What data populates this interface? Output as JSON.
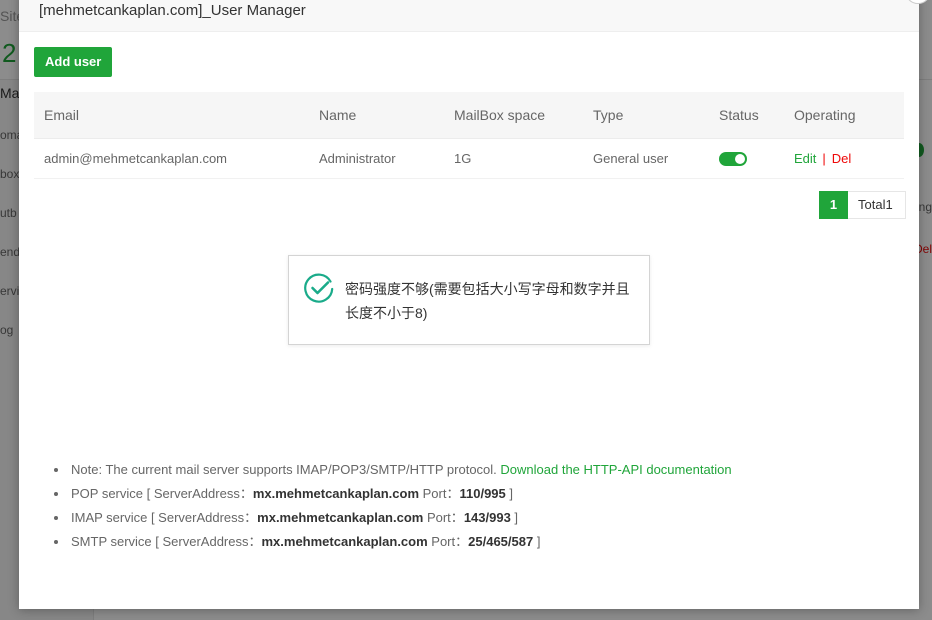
{
  "background": {
    "site_label": "Site",
    "big_number": "2",
    "mail_label": "Mail",
    "menu_items": [
      "oma",
      "box",
      "utb",
      "end",
      "ervi",
      "og"
    ],
    "right_ng": "ng",
    "right_del": "Del"
  },
  "modal": {
    "title": "[mehmetcankaplan.com]_User Manager",
    "close_glyph": "×"
  },
  "toolbar": {
    "add_user_label": "Add user"
  },
  "table": {
    "headers": {
      "email": "Email",
      "name": "Name",
      "mailbox": "MailBox space",
      "type": "Type",
      "status": "Status",
      "operating": "Operating"
    },
    "rows": [
      {
        "email": "admin@mehmetcankaplan.com",
        "name": "Administrator",
        "mailbox": "1G",
        "type": "General user",
        "status_enabled": true,
        "edit": "Edit",
        "separator": "|",
        "del": "Del"
      }
    ]
  },
  "pagination": {
    "current_page": "1",
    "total": "Total1"
  },
  "toast": {
    "icon": "check-circle-icon",
    "message": "密码强度不够(需要包括大小写字母和数字并且长度不小于8)"
  },
  "notes": {
    "note_prefix": "Note: The current mail server supports IMAP/POP3/SMTP/HTTP protocol.",
    "doc_link": "Download the HTTP-API documentation",
    "pop": {
      "label": "POP service [ ServerAddress：",
      "address": "mx.mehmetcankaplan.com",
      "port_label": " Port：",
      "port": "110/995",
      "end": " ]"
    },
    "imap": {
      "label": "IMAP service [ ServerAddress：",
      "address": "mx.mehmetcankaplan.com",
      "port_label": " Port：",
      "port": "143/993",
      "end": " ]"
    },
    "smtp": {
      "label": "SMTP service [ ServerAddress：",
      "address": "mx.mehmetcankaplan.com",
      "port_label": " Port：",
      "port": "25/465/587",
      "end": " ]"
    }
  },
  "colors": {
    "accent": "#20a53a",
    "danger": "#ef0808"
  }
}
